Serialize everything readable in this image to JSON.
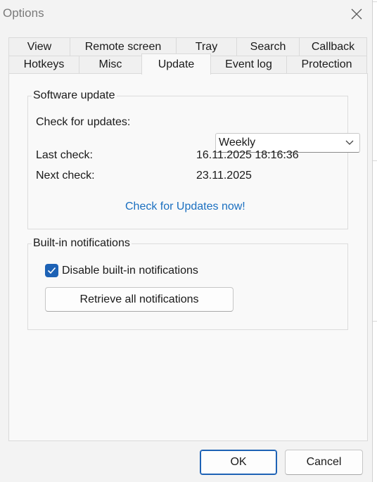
{
  "window": {
    "title": "Options",
    "close_icon": "close-icon"
  },
  "tabs": {
    "row1": [
      "View",
      "Remote screen",
      "Tray",
      "Search",
      "Callback"
    ],
    "row2": [
      "Hotkeys",
      "Misc",
      "Update",
      "Event log",
      "Protection"
    ],
    "active": "Update"
  },
  "software_update": {
    "group_title": "Software update",
    "check_label": "Check for updates:",
    "frequency_selected": "Weekly",
    "last_check_label": "Last check:",
    "last_check_value": "16.11.2025 18:16:36",
    "next_check_label": "Next check:",
    "next_check_value": "23.11.2025",
    "check_now_link": "Check for Updates now!"
  },
  "notifications": {
    "group_title": "Built-in notifications",
    "disable_label": "Disable built-in notifications",
    "disable_checked": true,
    "retrieve_button": "Retrieve all notifications"
  },
  "footer": {
    "ok": "OK",
    "cancel": "Cancel"
  },
  "colors": {
    "accent": "#1d62b5",
    "link": "#1a6fc0"
  }
}
